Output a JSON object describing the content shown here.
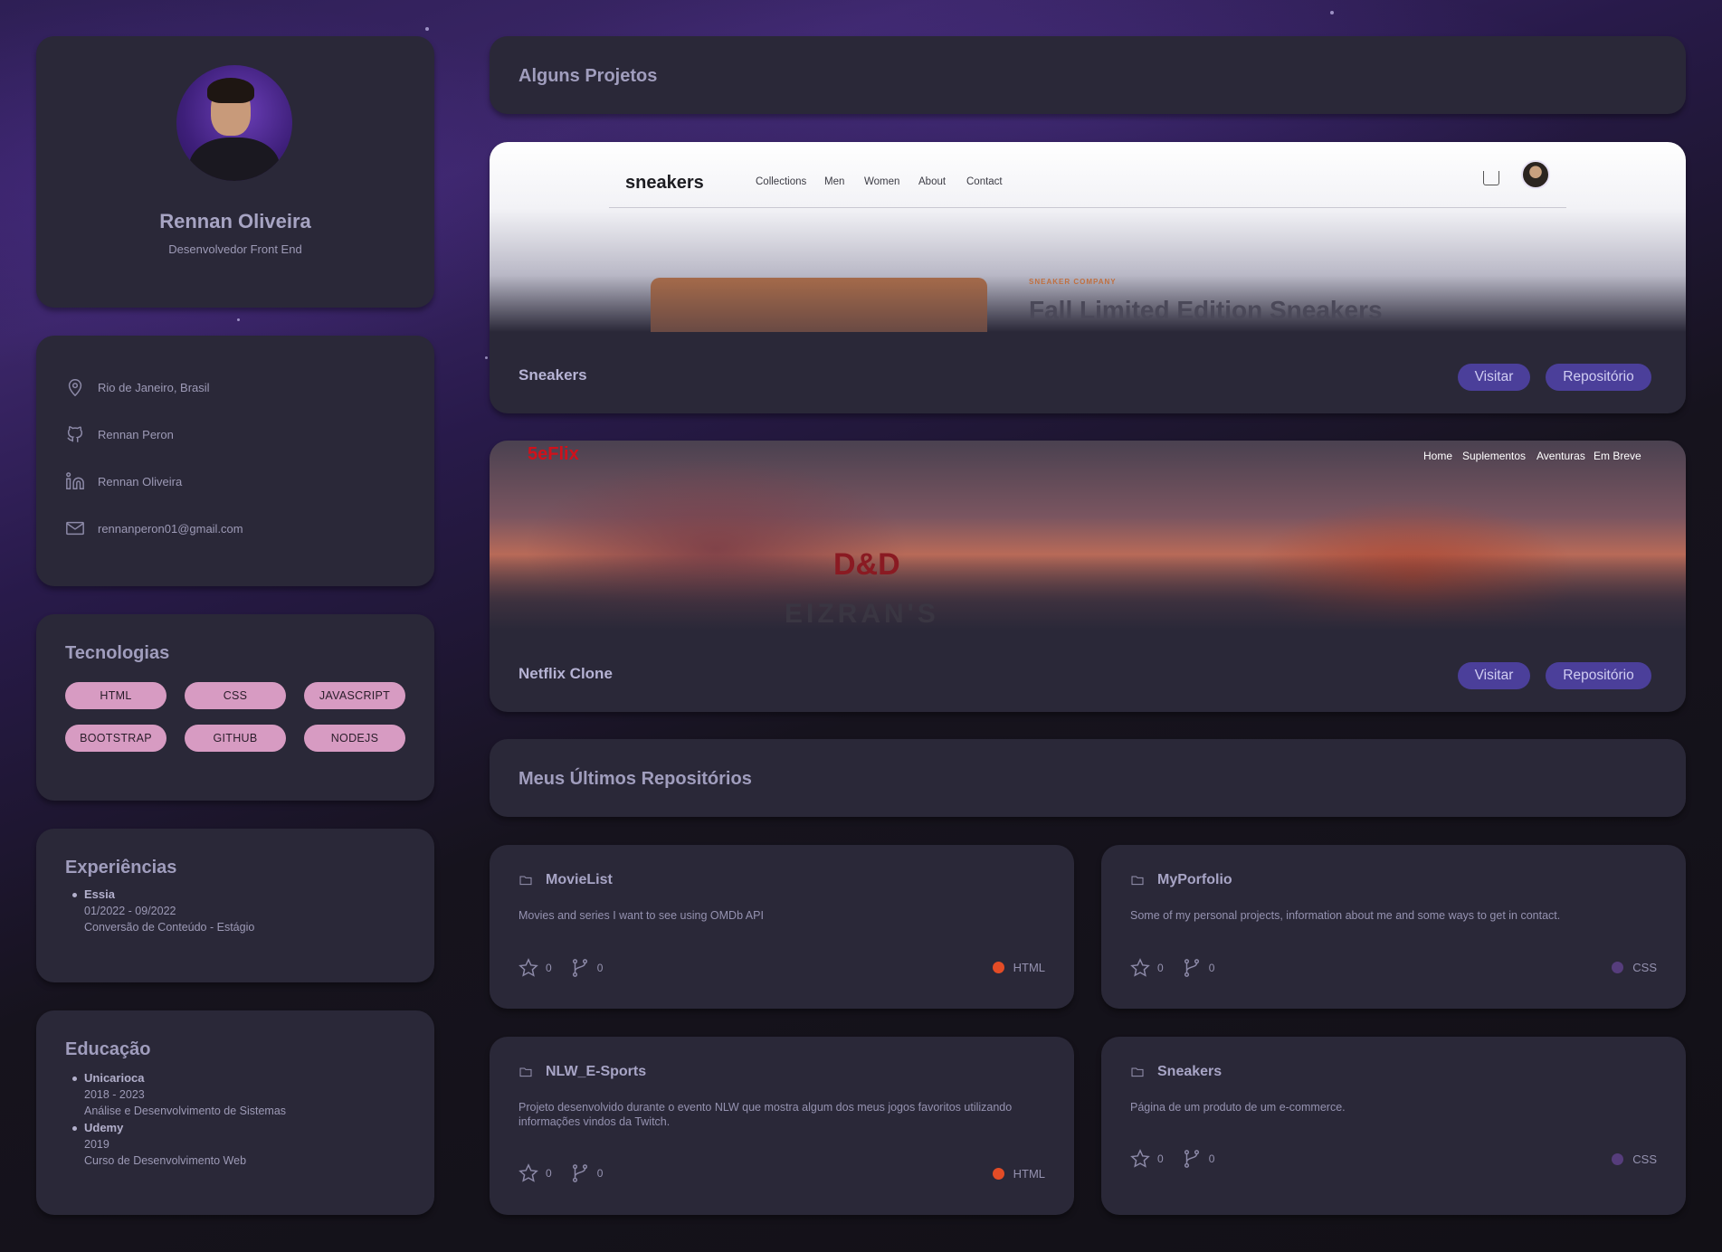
{
  "profile": {
    "name": "Rennan Oliveira",
    "role": "Desenvolvedor Front End"
  },
  "contacts": [
    {
      "icon": "map-pin-icon",
      "text": "Rio de Janeiro, Brasil"
    },
    {
      "icon": "github-icon",
      "text": "Rennan Peron"
    },
    {
      "icon": "linkedin-icon",
      "text": "Rennan Oliveira"
    },
    {
      "icon": "mail-icon",
      "text": "rennanperon01@gmail.com"
    }
  ],
  "technologies": {
    "title": "Tecnologias",
    "tags": [
      "HTML",
      "CSS",
      "JAVASCRIPT",
      "BOOTSTRAP",
      "GITHUB",
      "NODEJS"
    ]
  },
  "experience": {
    "title": "Experiências",
    "items": [
      {
        "title": "Essia",
        "period": "01/2022 - 09/2022",
        "desc": "Conversão de Conteúdo - Estágio"
      }
    ]
  },
  "education": {
    "title": "Educação",
    "items": [
      {
        "title": "Unicarioca",
        "period": "2018 - 2023",
        "desc": "Análise e Desenvolvimento de Sistemas"
      },
      {
        "title": "Udemy",
        "period": "2019",
        "desc": "Curso de Desenvolvimento Web"
      }
    ]
  },
  "projects": {
    "title": "Alguns Projetos",
    "items": [
      {
        "name": "Sneakers",
        "visit_label": "Visitar",
        "repo_label": "Repositório",
        "preview": {
          "logo": "sneakers",
          "nav": [
            "Collections",
            "Men",
            "Women",
            "About",
            "Contact"
          ],
          "kicker": "SNEAKER COMPANY",
          "headline": "Fall Limited Edition Sneakers"
        }
      },
      {
        "name": "Netflix Clone",
        "visit_label": "Visitar",
        "repo_label": "Repositório",
        "preview": {
          "logo": "5eFlix",
          "nav": [
            "Home",
            "Suplementos",
            "Aventuras",
            "Em Breve"
          ],
          "emblem": "D&D",
          "banner_text": "EIZRAN'S"
        }
      }
    ]
  },
  "repositories": {
    "title": "Meus Últimos Repositórios",
    "items": [
      {
        "name": "MovieList",
        "desc": "Movies and series I want to see using OMDb API",
        "stars": "0",
        "forks": "0",
        "lang": "HTML",
        "lang_color": "#e34c26"
      },
      {
        "name": "MyPorfolio",
        "desc": "Some of my personal projects, information about me and some ways to get in contact.",
        "stars": "0",
        "forks": "0",
        "lang": "CSS",
        "lang_color": "#563d7c"
      },
      {
        "name": "NLW_E-Sports",
        "desc": "Projeto desenvolvido durante o evento NLW que mostra algum dos meus jogos favoritos utilizando informações vindos da Twitch.",
        "stars": "0",
        "forks": "0",
        "lang": "HTML",
        "lang_color": "#e34c26"
      },
      {
        "name": "Sneakers",
        "desc": "Página de um produto de um e-commerce.",
        "stars": "0",
        "forks": "0",
        "lang": "CSS",
        "lang_color": "#563d7c"
      }
    ]
  }
}
